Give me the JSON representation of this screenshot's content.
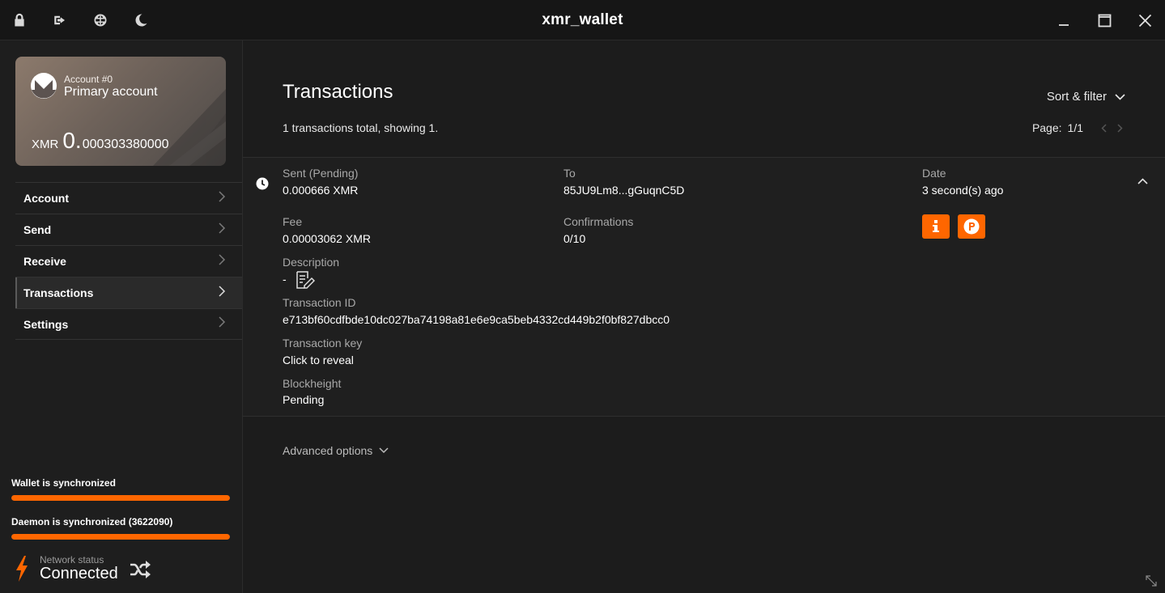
{
  "titlebar": {
    "title": "xmr_wallet",
    "icons": [
      "lock-icon",
      "logout-icon",
      "globe-icon",
      "moon-icon"
    ],
    "window_buttons": [
      "minimize-icon",
      "maximize-icon",
      "close-icon"
    ]
  },
  "account": {
    "number": "Account #0",
    "name": "Primary account",
    "unit": "XMR",
    "balance_int": "0.",
    "balance_dec": "000303380000"
  },
  "menu": [
    {
      "label": "Account",
      "active": false
    },
    {
      "label": "Send",
      "active": false
    },
    {
      "label": "Receive",
      "active": false
    },
    {
      "label": "Transactions",
      "active": true
    },
    {
      "label": "Settings",
      "active": false
    }
  ],
  "sync": {
    "wallet_label": "Wallet is synchronized",
    "wallet_progress": 1.0,
    "daemon_label": "Daemon is synchronized (3622090)",
    "daemon_progress": 1.0
  },
  "network": {
    "label": "Network status",
    "value": "Connected"
  },
  "main": {
    "title": "Transactions",
    "sort_filter": "Sort & filter",
    "count_text": "1 transactions total, showing 1.",
    "page_label": "Page:",
    "page_value": "1/1"
  },
  "transaction": {
    "type_label": "Sent (Pending)",
    "amount": "0.000666 XMR",
    "to_label": "To",
    "to_value": "85JU9Lm8...gGuqnC5D",
    "date_label": "Date",
    "date_value": "3 second(s) ago",
    "fee_label": "Fee",
    "fee_value": "0.00003062 XMR",
    "confirmations_label": "Confirmations",
    "confirmations_value": "0/10",
    "description_label": "Description",
    "description_value": "-",
    "txid_label": "Transaction ID",
    "txid_value": "e713bf60cdfbde10dc027ba74198a81e6e9ca5beb4332cd449b2f0bf827dbcc0",
    "txkey_label": "Transaction key",
    "txkey_value": "Click to reveal",
    "blockheight_label": "Blockheight",
    "blockheight_value": "Pending"
  },
  "advanced_options": "Advanced options",
  "colors": {
    "accent": "#ff6600",
    "background": "#1c1c1c",
    "card_gradient_start": "#8c7a6c"
  }
}
